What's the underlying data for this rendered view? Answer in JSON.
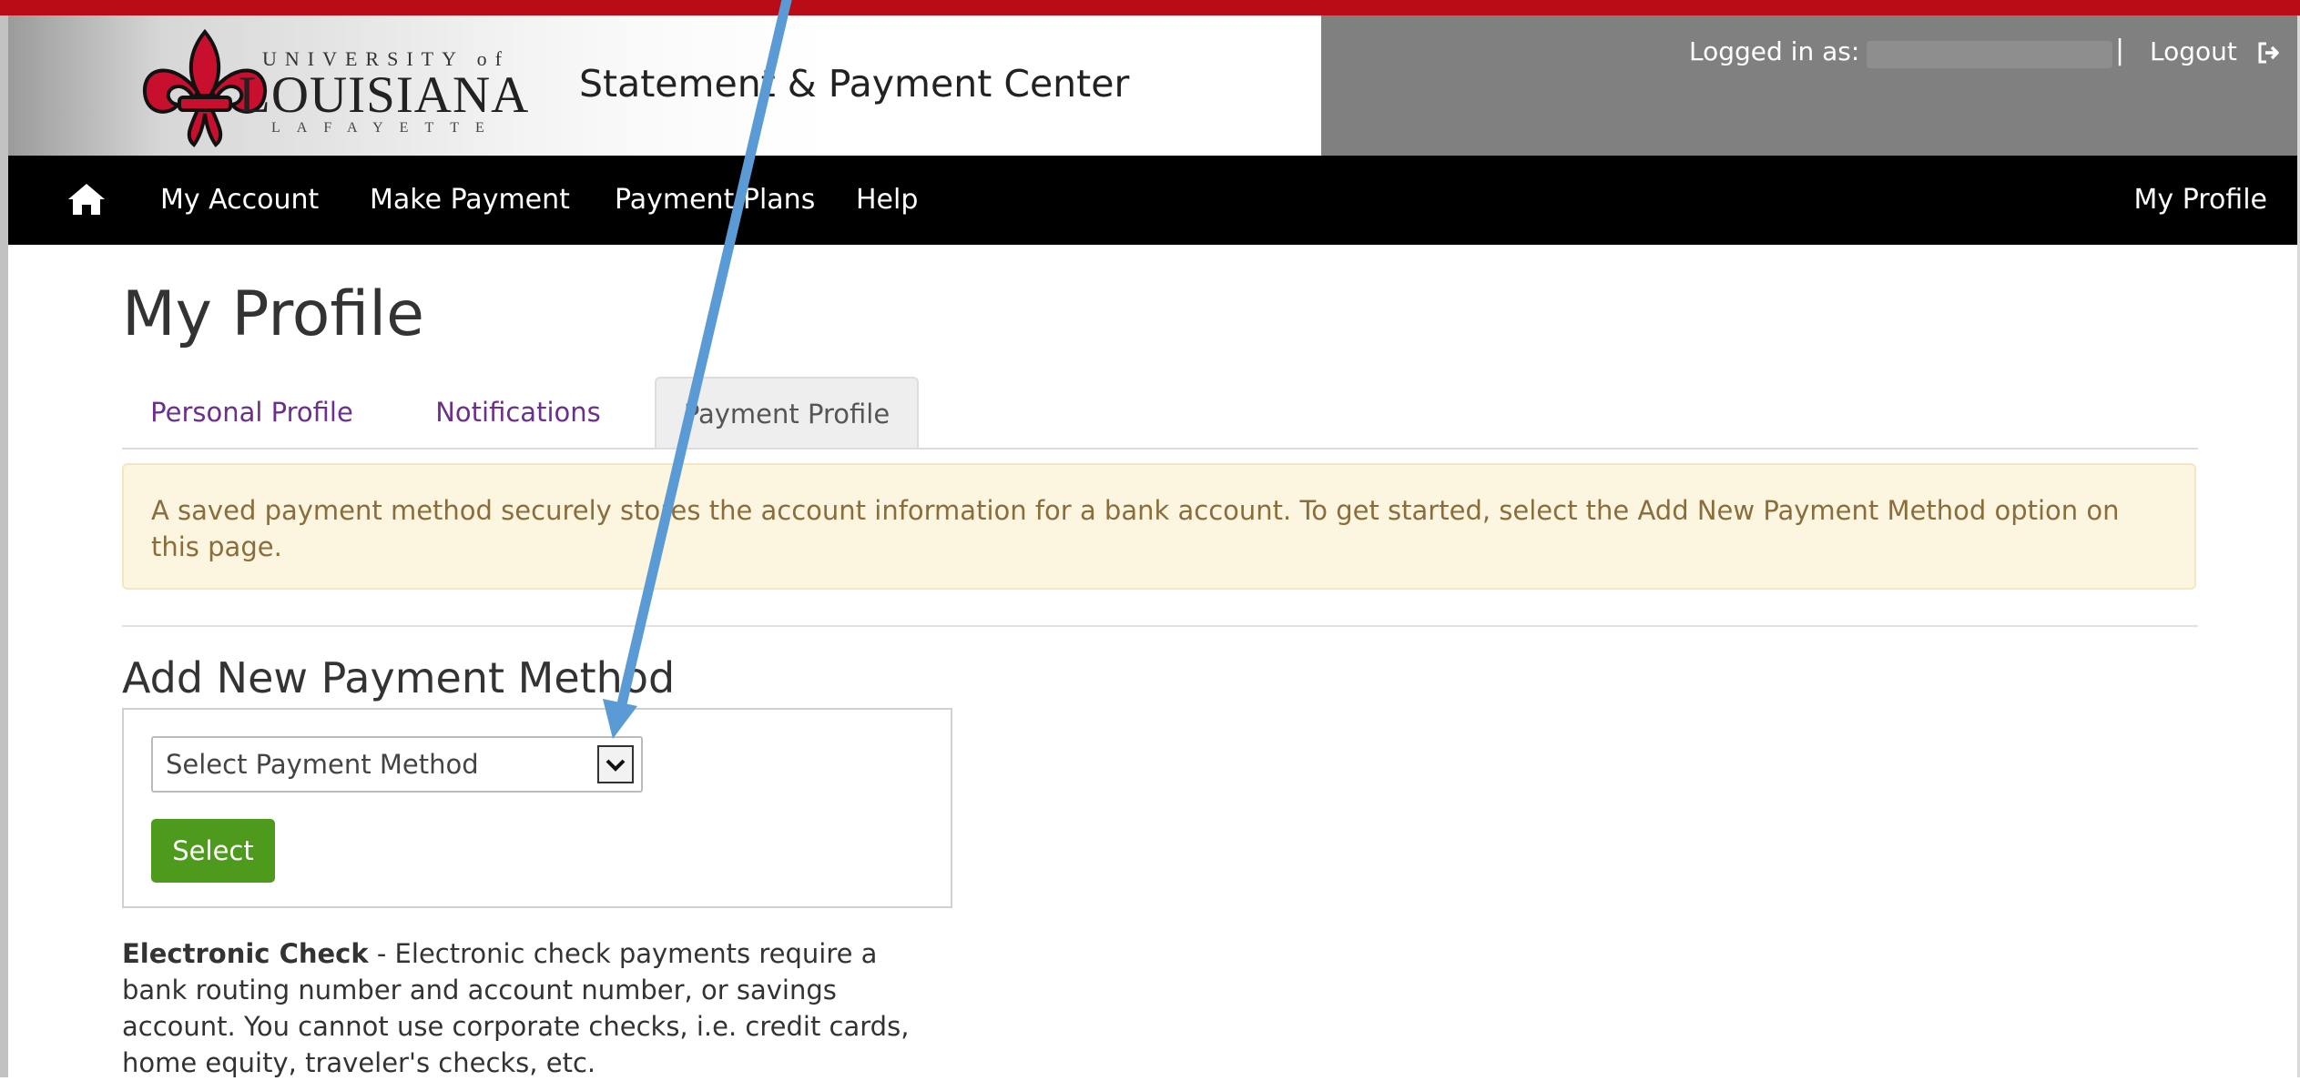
{
  "header": {
    "brand": {
      "line1": "UNIVERSITY of",
      "line2": "LOUISIANA",
      "line3": "LAFAYETTE"
    },
    "site_title": "Statement & Payment Center",
    "logged_in_label": "Logged in as:",
    "separator": "|",
    "logout_label": "Logout"
  },
  "nav": {
    "items": [
      {
        "label": "My Account"
      },
      {
        "label": "Make Payment"
      },
      {
        "label": "Payment Plans"
      },
      {
        "label": "Help"
      }
    ],
    "right_item": "My Profile"
  },
  "page": {
    "title": "My Profile",
    "tabs": [
      {
        "label": "Personal Profile",
        "active": false
      },
      {
        "label": "Notifications",
        "active": false
      },
      {
        "label": "Payment Profile",
        "active": true
      }
    ],
    "alert": "A saved payment method securely stores the account information for a bank account. To get started, select the Add New Payment Method option on this page."
  },
  "add_method": {
    "title": "Add New Payment Method",
    "select_placeholder": "Select Payment Method",
    "select_button": "Select"
  },
  "echeck": {
    "term": "Electronic Check",
    "description": " - Electronic check payments require a bank routing number and account number, or savings account. You cannot use corporate checks, i.e. credit cards, home equity, traveler's checks, etc."
  },
  "colors": {
    "accent_red": "#b80d17",
    "nav_black": "#000000",
    "header_gray": "#808080",
    "tab_link_purple": "#6b2f8c",
    "button_green": "#4e9a1d",
    "alert_bg": "#fcf6e1",
    "annotation_arrow": "#5b9bd5"
  },
  "icons": {
    "home": "home-icon",
    "logout": "logout-icon",
    "dropdown": "chevron-down-icon",
    "logo": "fleur-de-lis-icon"
  }
}
